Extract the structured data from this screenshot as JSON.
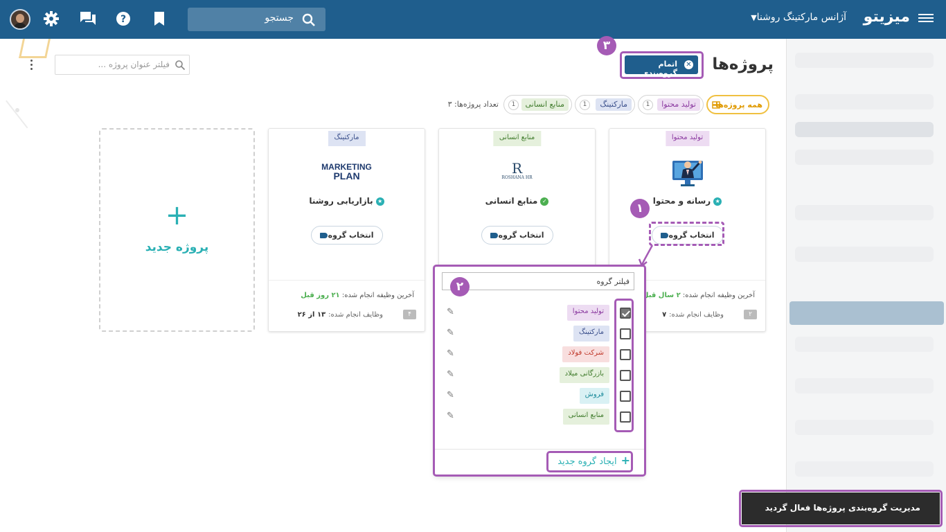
{
  "header": {
    "logo": "میزیتو",
    "agency": "آژانس مارکتینگ روشنا",
    "search_label": "جستجو",
    "icons": [
      "menu-icon",
      "search-icon",
      "bookmark-icon",
      "help-icon",
      "chat-icon",
      "gear-icon",
      "avatar"
    ]
  },
  "page": {
    "title": "پروژه‌ها",
    "end_grouping": "اتمام گروه‌بندی",
    "filter_placeholder": "فیلتر عنوان پروژه ...",
    "count_label": "تعداد پروژه‌ها:",
    "count_value": "۳"
  },
  "chips": [
    {
      "label": "همه پروژه‌ها",
      "count": ""
    },
    {
      "label": "تولید محتوا",
      "count": "1"
    },
    {
      "label": "مارکتینگ",
      "count": "1"
    },
    {
      "label": "منابع انسانی",
      "count": "1"
    }
  ],
  "cards": [
    {
      "category": "تولید محتوا",
      "name": "رسانه و محتوا",
      "button": "انتخاب گروه",
      "last_task_label": "آخرین وظیفه انجام شده:",
      "last_task_value": "۲ سال قبل",
      "done_label": "وظایف انجام شده:",
      "done_value": "۷",
      "group_count": "۲"
    },
    {
      "category": "منابع انسانی",
      "name": "منابع انسانی",
      "logo_letter": "R",
      "logo_text": "ROSHANA HR",
      "button": "انتخاب گروه"
    },
    {
      "category": "مارکتینگ",
      "name": "بازاریابی روشنا",
      "logo_line1": "MARKETING",
      "logo_line2": "PLAN",
      "button": "انتخاب گروه",
      "last_task_label": "آخرین وظیفه انجام شده:",
      "last_task_value": "۲۱ روز قبل",
      "done_label": "وظایف انجام شده:",
      "done_value": "۱۳ از ۲۶",
      "group_count": "۴"
    }
  ],
  "new_project": {
    "plus": "+",
    "label": "پروژه جدید"
  },
  "dropdown": {
    "filter_value": "فیلتر گروه",
    "groups": [
      {
        "label": "تولید محتوا",
        "checked": true
      },
      {
        "label": "مارکتینگ",
        "checked": false
      },
      {
        "label": "شرکت فولاد",
        "checked": false
      },
      {
        "label": "بازرگانی میلاد",
        "checked": false
      },
      {
        "label": "فروش",
        "checked": false
      },
      {
        "label": "منابع انسانی",
        "checked": false
      }
    ],
    "create_label": "ایجاد گروه جدید",
    "create_icon": "+"
  },
  "annotations": {
    "one": "۱",
    "two": "۲",
    "three": "۳"
  },
  "toast": "مدیریت گروه‌بندی پروژه‌ها فعال گردید",
  "colors": {
    "primary": "#1f5e8d",
    "accent": "#2ab0b4",
    "highlight": "#a55bb5",
    "toast": "#2c2c2c"
  }
}
